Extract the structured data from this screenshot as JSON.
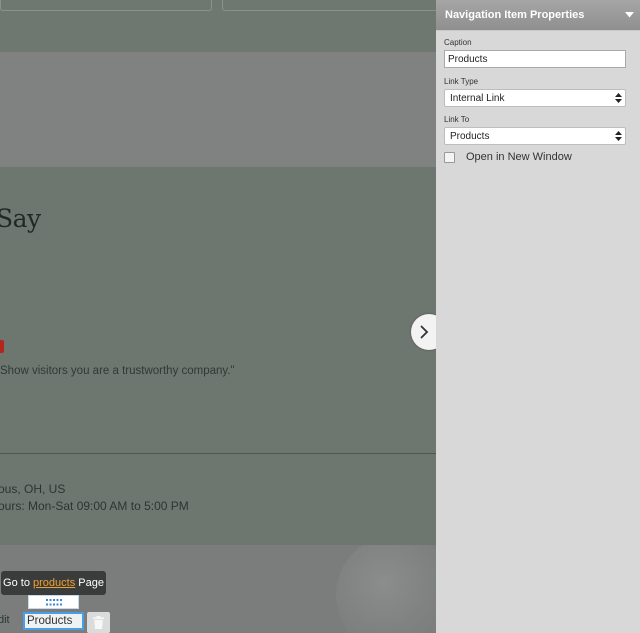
{
  "canvas": {
    "heading": "Say",
    "quote": "Show visitors you are a trustworthy company.\"",
    "address_line": "ous, OH, US",
    "hours_line": "ours: Mon-Sat 09:00 AM to 5:00 PM",
    "edit_word": "dit",
    "tooltip": {
      "prefix": "Go to",
      "link": "products",
      "suffix": "Page"
    },
    "inline_input_value": "Products"
  },
  "panel": {
    "title": "Navigation Item Properties",
    "caption_label": "Caption",
    "caption_value": "Products",
    "link_type_label": "Link Type",
    "link_type_value": "Internal Link",
    "link_to_label": "Link To",
    "link_to_value": "Products",
    "new_window_label": "Open in New Window"
  }
}
